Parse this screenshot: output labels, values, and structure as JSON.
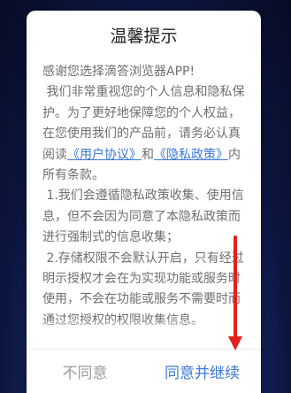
{
  "dialog": {
    "title": "温馨提示",
    "intro": "感谢您选择滴答浏览器APP!",
    "para1_start": "我们非常重视您的个人信息和隐私保护。为了更好地保障您的个人权益，在您使用我们的产品前，请务必认真阅读",
    "user_agreement_link": "《用户协议》",
    "para1_and": "和",
    "privacy_policy_link": "《隐私政策》",
    "para1_end": "内所有条款。",
    "clause1": "1.我们会遵循隐私政策收集、使用信息，但不会因为同意了本隐私政策而进行强制式的信息收集；",
    "clause2": "2.存储权限不会默认开启，只有经过明示授权才会在为实现功能或服务时使用，不会在功能或服务不需要时而通过您授权的权限收集信息。",
    "disagree_label": "不同意",
    "agree_label": "同意并继续"
  },
  "colors": {
    "link": "#3c79d6",
    "annotation_arrow": "#e0201e"
  }
}
